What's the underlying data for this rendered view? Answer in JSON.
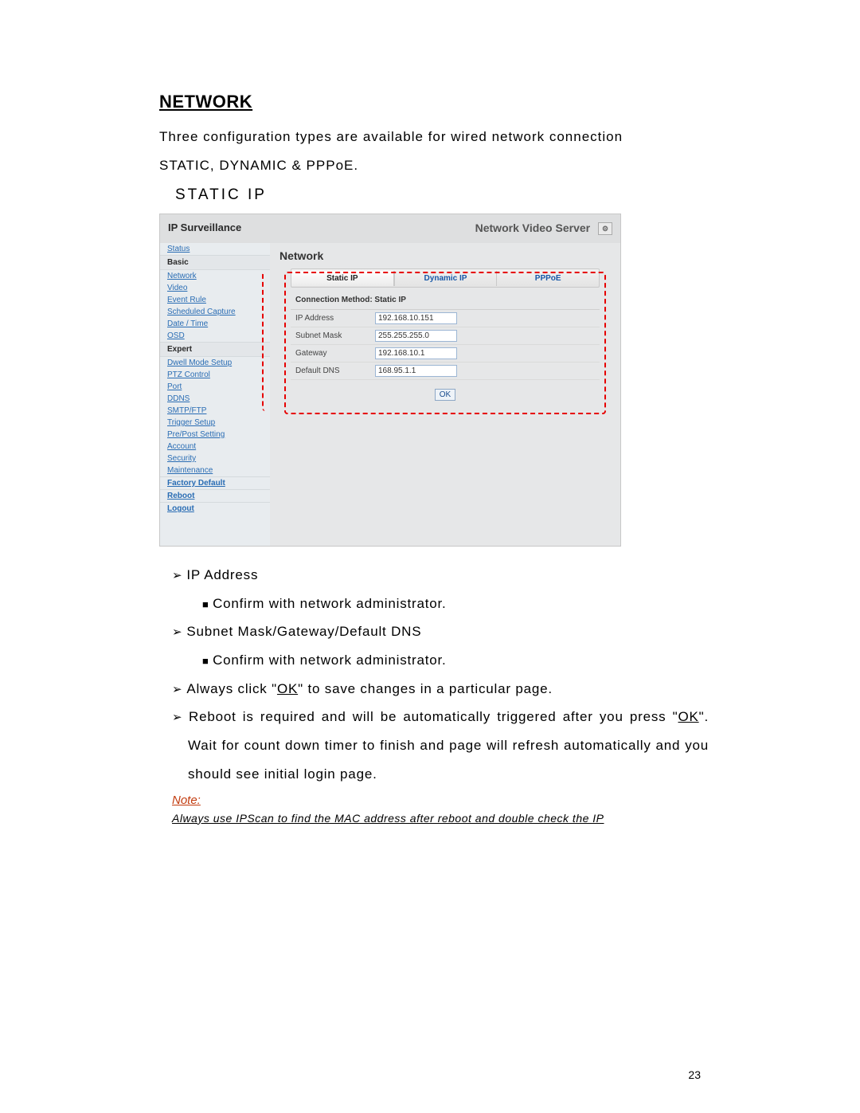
{
  "doc": {
    "heading": "NETWORK",
    "intro_line1": "Three configuration types are available for wired network connection",
    "intro_line2": "STATIC, DYNAMIC & PPPoE.",
    "section": "STATIC IP",
    "page_number": "23",
    "list": {
      "ip_address": "IP Address",
      "confirm": "Confirm with network administrator.",
      "subnet_group": "Subnet Mask/Gateway/Default DNS",
      "always_click_pre": "Always click \"",
      "ok": "OK",
      "always_click_post": "\" to save changes in a particular page.",
      "reboot_pre": "Reboot is required and will be automatically triggered after you press \"",
      "reboot_post": "\".  Wait for count down timer to finish and page will refresh automatically and you should see initial login page."
    },
    "note_label": "Note:",
    "note_text": "Always use IPScan to find the MAC address after reboot and double check the IP"
  },
  "ui": {
    "brand": "IP Surveillance",
    "title": "Network Video Server",
    "gear_glyph": "⚙",
    "sidebar": {
      "status": "Status",
      "group_basic": "Basic",
      "items_basic": [
        "Network",
        "Video",
        "Event Rule",
        "Scheduled Capture",
        "Date / Time",
        "OSD"
      ],
      "group_expert": "Expert",
      "items_expert": [
        "Dwell Mode Setup",
        "PTZ Control",
        "Port",
        "DDNS",
        "SMTP/FTP",
        "Trigger Setup",
        "Pre/Post Setting",
        "Account",
        "Security",
        "Maintenance"
      ],
      "factory_default": "Factory Default",
      "reboot": "Reboot",
      "logout": "Logout"
    },
    "main": {
      "heading": "Network",
      "tabs": {
        "static": "Static IP",
        "dynamic": "Dynamic IP",
        "pppoe": "PPPoE"
      },
      "form_caption": "Connection Method: Static IP",
      "rows": {
        "ip_label": "IP Address",
        "ip_value": "192.168.10.151",
        "mask_label": "Subnet Mask",
        "mask_value": "255.255.255.0",
        "gw_label": "Gateway",
        "gw_value": "192.168.10.1",
        "dns_label": "Default DNS",
        "dns_value": "168.95.1.1"
      },
      "ok": "OK"
    }
  }
}
